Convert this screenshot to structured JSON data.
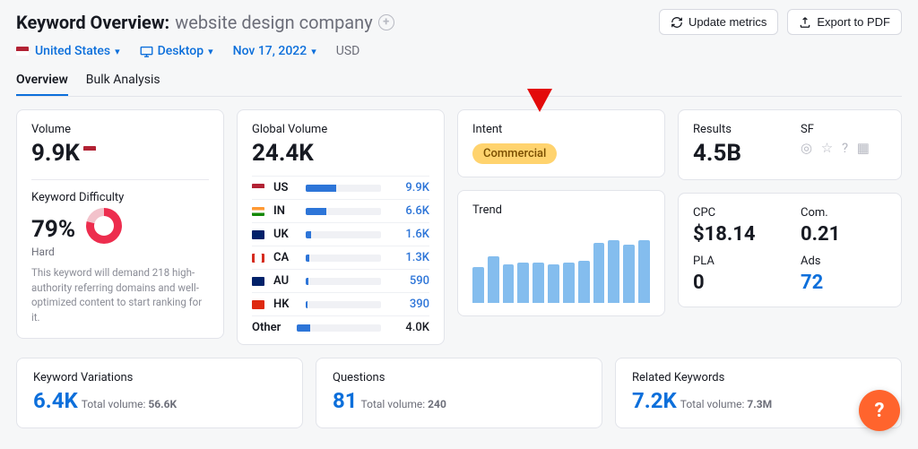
{
  "header": {
    "title_prefix": "Keyword Overview:",
    "keyword": "website design company",
    "update_label": "Update metrics",
    "export_label": "Export to PDF",
    "filters": {
      "country": "United States",
      "device": "Desktop",
      "date": "Nov 17, 2022",
      "currency": "USD"
    }
  },
  "tabs": {
    "overview": "Overview",
    "bulk": "Bulk Analysis"
  },
  "volume": {
    "label": "Volume",
    "value": "9.9K",
    "kd_label": "Keyword Difficulty",
    "kd_percent": "79%",
    "kd_level": "Hard",
    "note": "This keyword will demand 218 high-authority referring domains and well-optimized content to start ranking for it."
  },
  "global_volume": {
    "label": "Global Volume",
    "value": "24.4K",
    "rows": [
      {
        "cc": "US",
        "val": "9.9K",
        "pct": 41,
        "flag": "us"
      },
      {
        "cc": "IN",
        "val": "6.6K",
        "pct": 27,
        "flag": "in"
      },
      {
        "cc": "UK",
        "val": "1.6K",
        "pct": 7,
        "flag": "uk"
      },
      {
        "cc": "CA",
        "val": "1.3K",
        "pct": 5,
        "flag": "ca"
      },
      {
        "cc": "AU",
        "val": "590",
        "pct": 3,
        "flag": "au"
      },
      {
        "cc": "HK",
        "val": "390",
        "pct": 2,
        "flag": "hk"
      }
    ],
    "other_label": "Other",
    "other_val": "4.0K",
    "other_pct": 16
  },
  "intent": {
    "label": "Intent",
    "badge": "Commercial"
  },
  "trend": {
    "label": "Trend"
  },
  "stats": {
    "results_label": "Results",
    "results": "4.5B",
    "sf_label": "SF",
    "cpc_label": "CPC",
    "cpc": "$18.14",
    "com_label": "Com.",
    "com": "0.21",
    "pla_label": "PLA",
    "pla": "0",
    "ads_label": "Ads",
    "ads": "72"
  },
  "bottom": {
    "variations": {
      "title": "Keyword Variations",
      "value": "6.4K",
      "sub_label": "Total volume:",
      "sub_value": "56.6K"
    },
    "questions": {
      "title": "Questions",
      "value": "81",
      "sub_label": "Total volume:",
      "sub_value": "240"
    },
    "related": {
      "title": "Related Keywords",
      "value": "7.2K",
      "sub_label": "Total volume:",
      "sub_value": "7.3M"
    }
  },
  "chart_data": {
    "type": "bar",
    "title": "Trend",
    "categories": [
      "1",
      "2",
      "3",
      "4",
      "5",
      "6",
      "7",
      "8",
      "9",
      "10",
      "11",
      "12"
    ],
    "values": [
      45,
      58,
      48,
      50,
      50,
      48,
      50,
      52,
      75,
      78,
      72,
      78
    ],
    "ylim": [
      0,
      100
    ]
  }
}
